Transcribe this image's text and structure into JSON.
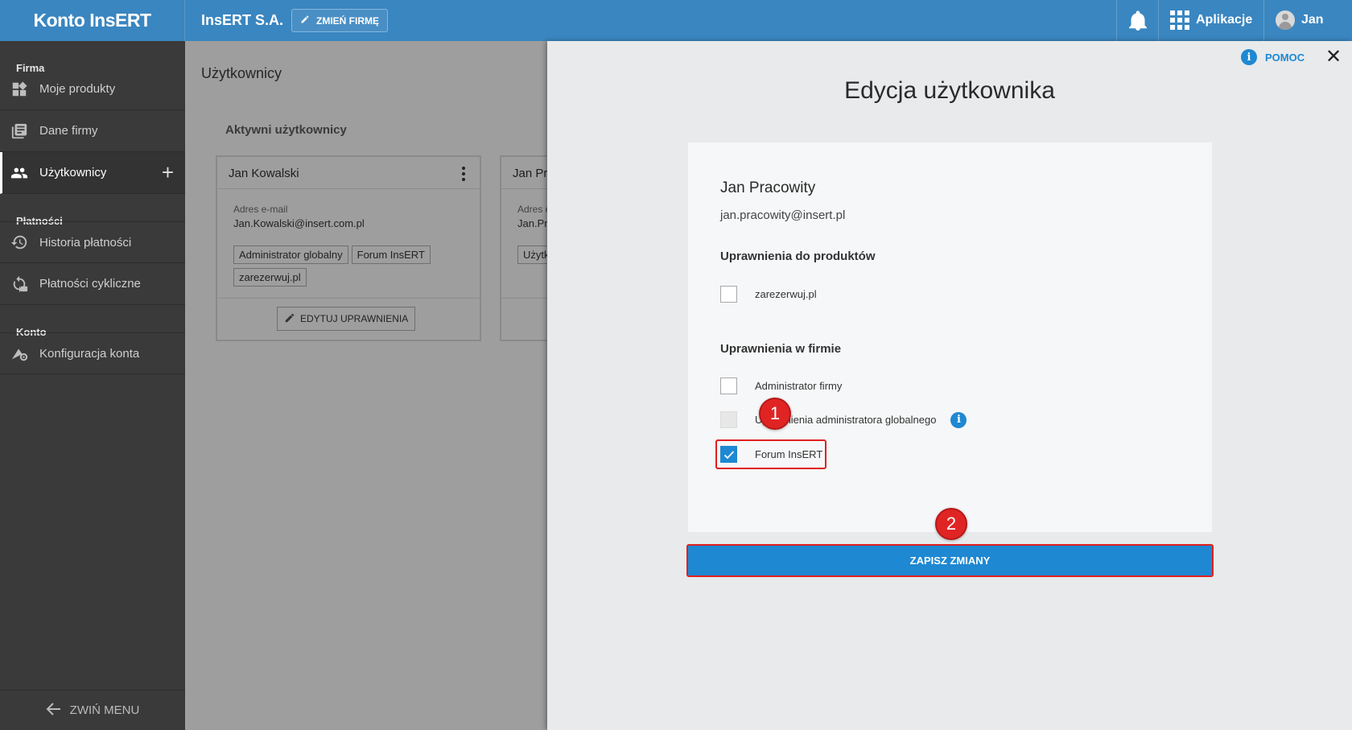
{
  "topbar": {
    "brand": "Konto InsERT",
    "company": "InsERT S.A.",
    "change_company": "ZMIEŃ FIRMĘ",
    "apps": "Aplikacje",
    "user": "Jan"
  },
  "sidebar": {
    "sections": [
      {
        "title": "Firma",
        "items": [
          {
            "label": "Moje produkty",
            "icon": "widgets-icon"
          },
          {
            "label": "Dane firmy",
            "icon": "document-icon"
          },
          {
            "label": "Użytkownicy",
            "icon": "users-icon",
            "active": true
          }
        ]
      },
      {
        "title": "Płatności",
        "items": [
          {
            "label": "Historia płatności",
            "icon": "history-icon"
          },
          {
            "label": "Płatności cykliczne",
            "icon": "recurring-icon"
          }
        ]
      },
      {
        "title": "Konto",
        "items": [
          {
            "label": "Konfiguracja konta",
            "icon": "account-settings-icon"
          }
        ]
      }
    ],
    "collapse": "ZWIŃ MENU"
  },
  "main": {
    "title": "Użytkownicy",
    "section": "Aktywni użytkownicy",
    "cards": [
      {
        "name": "Jan Kowalski",
        "email_label": "Adres e-mail",
        "email": "Jan.Kowalski@insert.com.pl",
        "tags": [
          "Administrator globalny",
          "Forum InsERT",
          "zarezerwuj.pl"
        ],
        "edit": "EDYTUJ UPRAWNIENIA"
      },
      {
        "name": "Jan Pr",
        "email_label": "Adres e",
        "email": "Jan.Pr",
        "tags": [
          "Użytk"
        ]
      }
    ]
  },
  "drawer": {
    "help": "POMOC",
    "title": "Edycja użytkownika",
    "user_name": "Jan Pracowity",
    "user_email": "jan.pracowity@insert.pl",
    "product_perms_title": "Uprawnienia do produktów",
    "product_perms": [
      {
        "label": "zarezerwuj.pl",
        "checked": false
      }
    ],
    "company_perms_title": "Uprawnienia w firmie",
    "company_perms": [
      {
        "label": "Administrator firmy",
        "checked": false,
        "disabled": false
      },
      {
        "label": "Uprawnienia administratora globalnego",
        "checked": false,
        "disabled": true
      },
      {
        "label": "Forum InsERT",
        "checked": true,
        "disabled": false
      }
    ],
    "save": "ZAPISZ ZMIANY"
  },
  "annotations": {
    "marker1": "1",
    "marker2": "2",
    "color": "#e02424"
  },
  "colors": {
    "topbar": "#3a86c0",
    "accent": "#1e88d2",
    "sidebar": "#3a3a3a"
  }
}
